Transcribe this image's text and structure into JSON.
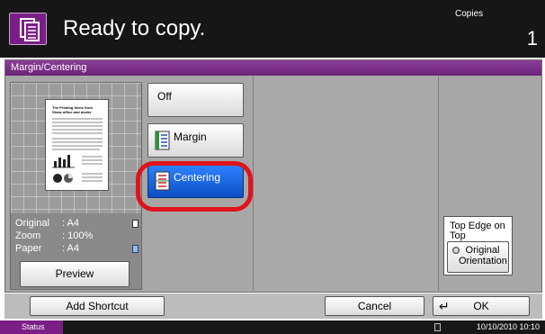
{
  "header": {
    "status_text": "Ready to copy.",
    "copies_label": "Copies",
    "copies_value": "1",
    "icon": "copy-document-icon"
  },
  "panel": {
    "title": "Margin/Centering",
    "preview": {
      "sample_page": {
        "heading_lines": [
          "The Printing items from",
          "Show office and dealer"
        ]
      },
      "info": [
        {
          "label": "Original",
          "value": ": A4",
          "icon": "paper-icon"
        },
        {
          "label": "Zoom",
          "value": ": 100%",
          "icon": ""
        },
        {
          "label": "Paper",
          "value": ": A4",
          "icon": "paper-tray-icon"
        }
      ],
      "button_label": "Preview"
    },
    "options": {
      "off_label": "Off",
      "margin_label": "Margin",
      "centering_label": "Centering",
      "selected": "Centering"
    },
    "top_edge": {
      "label": "Top Edge on Top",
      "button_label": "Original Orientation"
    }
  },
  "bottom_bar": {
    "add_shortcut_label": "Add Shortcut",
    "cancel_label": "Cancel",
    "ok_label": "OK",
    "ok_icon": "enter-icon"
  },
  "status_bar": {
    "status_label": "Status",
    "datetime": "10/10/2010  10:10"
  },
  "colors": {
    "header_bg": "#161616",
    "accent_purple": "#7a1f86",
    "selected_blue": "#1a66e6",
    "highlight_red": "#e0131b",
    "panel_gray": "#a7a7a7"
  }
}
